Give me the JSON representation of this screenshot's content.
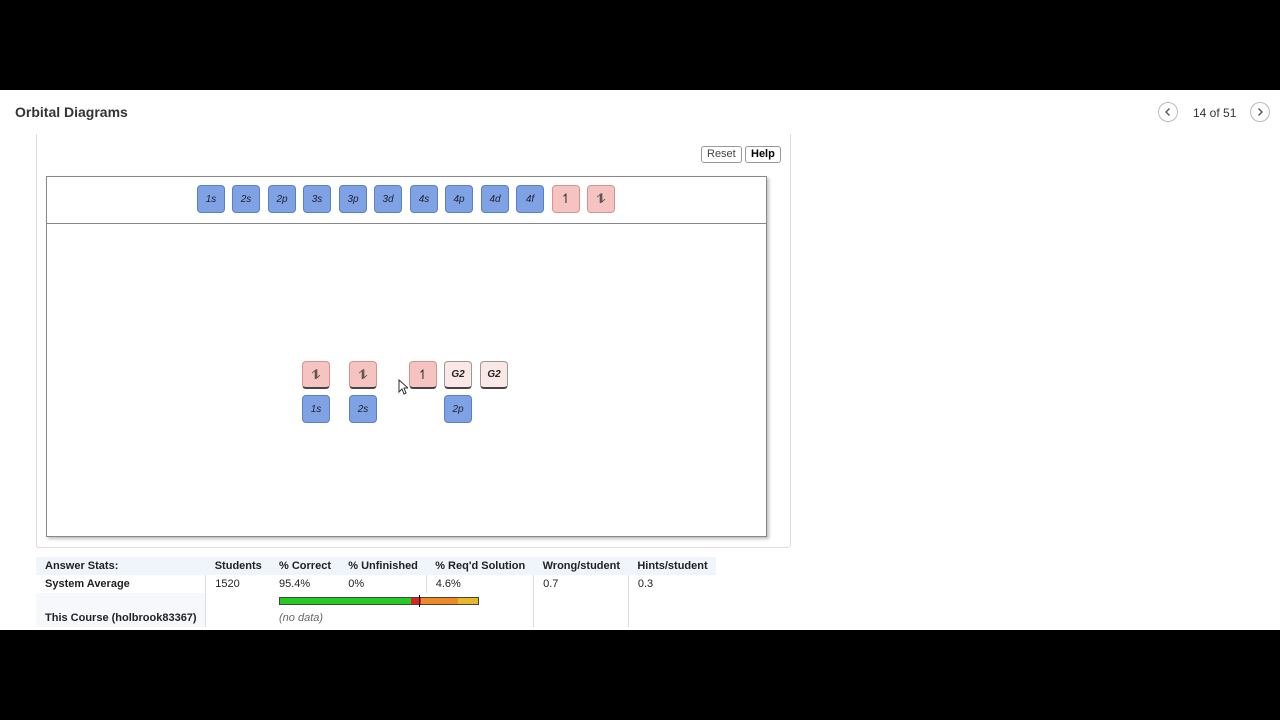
{
  "header": {
    "title": "Orbital Diagrams",
    "page_count": "14 of 51",
    "prev_icon": "chevron-left-icon",
    "next_icon": "chevron-right-icon"
  },
  "toolbar": {
    "reset_label": "Reset",
    "help_label": "Help"
  },
  "palette": {
    "orbitals": [
      "1s",
      "2s",
      "2p",
      "3s",
      "3p",
      "3d",
      "4s",
      "4p",
      "4d",
      "4f"
    ],
    "single_electron": "↿",
    "paired_electrons": "⥮"
  },
  "diagram": {
    "electron_boxes": [
      "⥮",
      "⥮",
      "↿",
      "G2",
      "G2"
    ],
    "orbital_labels": [
      "1s",
      "2s",
      "2p"
    ]
  },
  "stats": {
    "headers": [
      "Answer Stats:",
      "Students",
      "% Correct",
      "% Unfinished",
      "% Req'd Solution",
      "Wrong/student",
      "Hints/student"
    ],
    "system_average": {
      "label": "System Average",
      "students": "1520",
      "pct_correct": "95.4%",
      "pct_unfinished": "0%",
      "pct_reqd_solution": "4.6%",
      "wrong_per_student": "0.7",
      "hints_per_student": "0.3"
    },
    "bar": {
      "segments": [
        {
          "fraction": 0.66,
          "color": "#22cc22"
        },
        {
          "fraction": 0.05,
          "color": "#dd2222"
        },
        {
          "fraction": 0.19,
          "color": "#f08a24"
        },
        {
          "fraction": 0.1,
          "color": "#e6b82a"
        }
      ],
      "marker_fraction": 0.7
    },
    "this_course": {
      "label": "This Course (holbrook83367)",
      "value": "(no data)"
    }
  },
  "colors": {
    "orbital_tile": "#7fa2e4",
    "electron_tile": "#f6c4c0",
    "header_band": "#f0f4fb"
  }
}
